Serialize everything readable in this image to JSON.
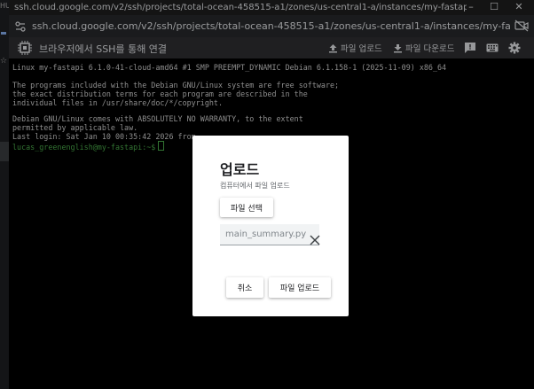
{
  "left_strip": {
    "text": "HUI",
    "star": "☆"
  },
  "window": {
    "url": "ssh.cloud.google.com/v2/ssh/projects/total-ocean-458515-a1/zones/us-central1-a/instances/my-fastapi?authuser=0&hl=ko&projectN...",
    "controls": {
      "minimize": "–",
      "maximize": "☐",
      "close": "✕"
    },
    "address": "ssh.cloud.google.com/v2/ssh/projects/total-ocean-458515-a1/zones/us-central1-a/instances/my-fastapi?authuser=0&hl=ko&projectNum..."
  },
  "toolbar": {
    "title": "브라우저에서 SSH를 통해 연결",
    "upload_label": "파일 업로드",
    "download_label": "파일 다운로드",
    "icons": [
      "upload-icon",
      "download-icon",
      "feedback-icon",
      "keyboard-icon",
      "gear-icon"
    ]
  },
  "terminal": {
    "lines": [
      "Linux my-fastapi 6.1.0-41-cloud-amd64 #1 SMP PREEMPT_DYNAMIC Debian 6.1.158-1 (2025-11-09) x86_64",
      "",
      "The programs included with the Debian GNU/Linux system are free software;",
      "the exact distribution terms for each program are described in the",
      "individual files in /usr/share/doc/*/copyright.",
      "",
      "Debian GNU/Linux comes with ABSOLUTELY NO WARRANTY, to the extent",
      "permitted by applicable law.",
      "Last login: Sat Jan 10 00:35:42 2026 from"
    ],
    "prompt": "lucas_greenenglish@my-fastapi:~$"
  },
  "dialog": {
    "title": "업로드",
    "subtitle": "컴퓨터에서 파일 업로드",
    "choose_file": "파일 선택",
    "file_name": "main_summary.py",
    "cancel": "취소",
    "upload": "파일 업로드"
  },
  "colors": {
    "terminal_bg": "#000000",
    "prompt_green": "#4eb24e",
    "toolbar_bg": "#303134"
  }
}
